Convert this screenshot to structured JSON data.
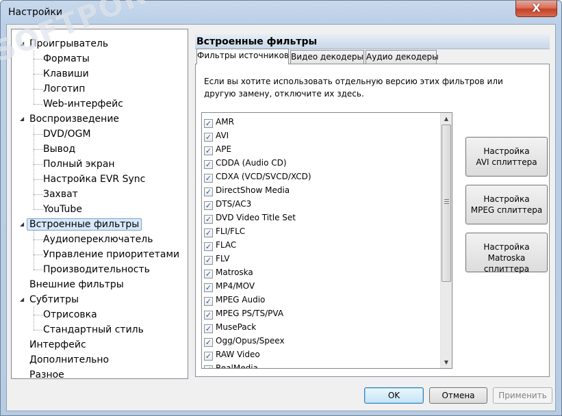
{
  "window": {
    "title": "Настройки",
    "close_glyph": "X"
  },
  "watermark": "SOFTPORTAL",
  "tree": {
    "items": [
      {
        "label": "Проигрыватель",
        "level": 0,
        "expanded": true
      },
      {
        "label": "Форматы",
        "level": 1
      },
      {
        "label": "Клавиши",
        "level": 1
      },
      {
        "label": "Логотип",
        "level": 1
      },
      {
        "label": "Web-интерфейс",
        "level": 1
      },
      {
        "label": "Воспроизведение",
        "level": 0,
        "expanded": true
      },
      {
        "label": "DVD/OGM",
        "level": 1
      },
      {
        "label": "Вывод",
        "level": 1
      },
      {
        "label": "Полный экран",
        "level": 1
      },
      {
        "label": "Настройка EVR Sync",
        "level": 1
      },
      {
        "label": "Захват",
        "level": 1
      },
      {
        "label": "YouTube",
        "level": 1
      },
      {
        "label": "Встроенные фильтры",
        "level": 0,
        "expanded": true,
        "selected": true
      },
      {
        "label": "Аудиопереключатель",
        "level": 1
      },
      {
        "label": "Управление приоритетами",
        "level": 1
      },
      {
        "label": "Производительность",
        "level": 1
      },
      {
        "label": "Внешние фильтры",
        "level": 0
      },
      {
        "label": "Субтитры",
        "level": 0,
        "expanded": true
      },
      {
        "label": "Отрисовка",
        "level": 1
      },
      {
        "label": "Стандартный стиль",
        "level": 1
      },
      {
        "label": "Интерфейс",
        "level": 0
      },
      {
        "label": "Дополнительно",
        "level": 0
      },
      {
        "label": "Разное",
        "level": 0
      }
    ]
  },
  "panel": {
    "title": "Встроенные фильтры",
    "tabs": [
      {
        "label": "Фильтры источников",
        "active": true
      },
      {
        "label": "Видео декодеры",
        "active": false
      },
      {
        "label": "Аудио декодеры",
        "active": false
      }
    ],
    "description": "Если вы хотите использовать отдельную версию этих фильтров или другую замену, отключите их здесь.",
    "filters": [
      {
        "label": "AMR",
        "checked": true
      },
      {
        "label": "AVI",
        "checked": true
      },
      {
        "label": "APE",
        "checked": true
      },
      {
        "label": "CDDA (Audio CD)",
        "checked": true
      },
      {
        "label": "CDXA (VCD/SVCD/XCD)",
        "checked": true
      },
      {
        "label": "DirectShow Media",
        "checked": true
      },
      {
        "label": "DTS/AC3",
        "checked": true
      },
      {
        "label": "DVD Video Title Set",
        "checked": true
      },
      {
        "label": "FLI/FLC",
        "checked": true
      },
      {
        "label": "FLAC",
        "checked": true
      },
      {
        "label": "FLV",
        "checked": true
      },
      {
        "label": "Matroska",
        "checked": true
      },
      {
        "label": "MP4/MOV",
        "checked": true
      },
      {
        "label": "MPEG Audio",
        "checked": true
      },
      {
        "label": "MPEG PS/TS/PVA",
        "checked": true
      },
      {
        "label": "MusePack",
        "checked": true
      },
      {
        "label": "Ogg/Opus/Speex",
        "checked": true
      },
      {
        "label": "RAW Video",
        "checked": true
      },
      {
        "label": "RealMedia",
        "checked": true
      }
    ],
    "side_buttons": [
      {
        "line1": "Настройка",
        "line2": "AVI сплиттера"
      },
      {
        "line1": "Настройка",
        "line2": "MPEG сплиттера"
      },
      {
        "line1": "Настройка",
        "line2": "Matroska сплиттера"
      }
    ]
  },
  "footer": {
    "ok_label": "OK",
    "cancel_label": "Отмена",
    "apply_label": "Применить"
  }
}
